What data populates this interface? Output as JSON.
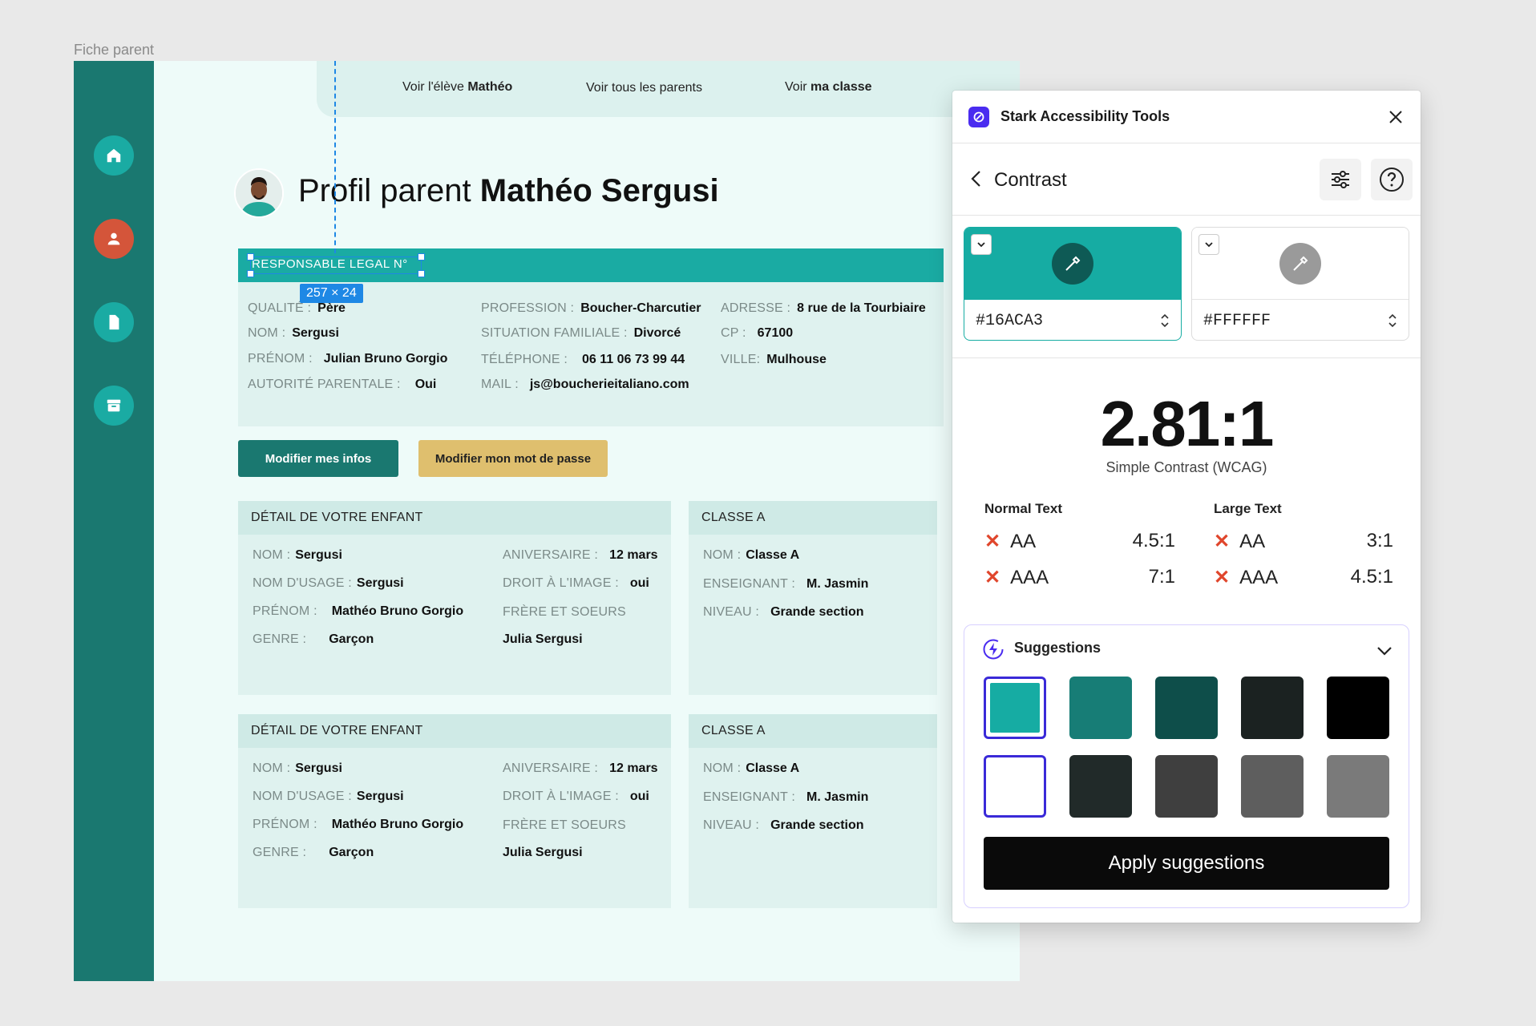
{
  "canvas": {
    "frame_label": "Fiche parent"
  },
  "topnav": [
    {
      "prefix": "Voir l'élève ",
      "bold": "Mathéo"
    },
    {
      "prefix": "Voir tous les parents",
      "bold": ""
    },
    {
      "prefix": "Voir ",
      "bold": "ma classe"
    }
  ],
  "page": {
    "title_prefix": "Profil parent ",
    "title_name": "Mathéo Sergusi"
  },
  "section_bar": {
    "label": "RESPONSABLE LEGAL N°",
    "selection_size": "257 × 24"
  },
  "parent_info": {
    "qualite": {
      "label": "QUALITÉ :",
      "value": "Père"
    },
    "nom": {
      "label": "NOM :",
      "value": "Sergusi"
    },
    "prenom": {
      "label": "PRÉNOM :",
      "value": "Julian Bruno Gorgio"
    },
    "autorite": {
      "label": "AUTORITÉ PARENTALE :",
      "value": "Oui"
    },
    "profession": {
      "label": "PROFESSION :",
      "value": "Boucher-Charcutier"
    },
    "situation": {
      "label": "SITUATION FAMILIALE :",
      "value": "Divorcé"
    },
    "telephone": {
      "label": "TÉLÉPHONE :",
      "value": "06 11 06 73 99 44"
    },
    "mail": {
      "label": "MAIL :",
      "value": "js@boucherieitaliano.com"
    },
    "adresse": {
      "label": "ADRESSE :",
      "value": "8 rue de la Tourbiaire"
    },
    "cp": {
      "label": "CP :",
      "value": "67100"
    },
    "ville": {
      "label": "VILLE:",
      "value": "Mulhouse"
    }
  },
  "buttons": {
    "edit_info": "Modifier mes infos",
    "edit_password": "Modifier mon mot de passe"
  },
  "children": [
    {
      "title": "DÉTAIL DE VOTRE ENFANT",
      "nom": {
        "label": "NOM :",
        "value": "Sergusi"
      },
      "nom_usage": {
        "label": "NOM D'USAGE :",
        "value": "Sergusi"
      },
      "prenom": {
        "label": "PRÉNOM :",
        "value": "Mathéo Bruno Gorgio"
      },
      "genre": {
        "label": "GENRE :",
        "value": "Garçon"
      },
      "anniversaire": {
        "label": "ANIVERSAIRE :",
        "value": "12 mars"
      },
      "droit_image": {
        "label": "DROIT À L'IMAGE :",
        "value": "oui"
      },
      "freres": {
        "label": "FRÈRE ET SOEURS",
        "value": "Julia Sergusi"
      },
      "classe": {
        "title": "CLASSE A",
        "nom": {
          "label": "NOM :",
          "value": "Classe A"
        },
        "enseignant": {
          "label": "ENSEIGNANT :",
          "value": "M. Jasmin"
        },
        "niveau": {
          "label": "NIVEAU :",
          "value": "Grande section"
        }
      }
    },
    {
      "title": "DÉTAIL DE VOTRE ENFANT",
      "nom": {
        "label": "NOM :",
        "value": "Sergusi"
      },
      "nom_usage": {
        "label": "NOM D'USAGE :",
        "value": "Sergusi"
      },
      "prenom": {
        "label": "PRÉNOM :",
        "value": "Mathéo Bruno Gorgio"
      },
      "genre": {
        "label": "GENRE :",
        "value": "Garçon"
      },
      "anniversaire": {
        "label": "ANIVERSAIRE :",
        "value": "12 mars"
      },
      "droit_image": {
        "label": "DROIT À L'IMAGE :",
        "value": "oui"
      },
      "freres": {
        "label": "FRÈRE ET SOEURS",
        "value": "Julia Sergusi"
      },
      "classe": {
        "title": "CLASSE A",
        "nom": {
          "label": "NOM :",
          "value": "Classe A"
        },
        "enseignant": {
          "label": "ENSEIGNANT :",
          "value": "M. Jasmin"
        },
        "niveau": {
          "label": "NIVEAU :",
          "value": "Grande section"
        }
      }
    }
  ],
  "sidebar_icons": [
    "home-icon",
    "user-icon",
    "document-icon",
    "archive-icon"
  ],
  "stark": {
    "title": "Stark Accessibility Tools",
    "subtitle": "Contrast",
    "foreground": {
      "hex": "#16ACA3"
    },
    "background": {
      "hex": "#FFFFFF"
    },
    "ratio": "2.81:1",
    "ratio_label": "Simple Contrast (WCAG)",
    "normal_text": {
      "heading": "Normal Text",
      "aa": {
        "label": "AA",
        "target": "4.5:1",
        "pass": false
      },
      "aaa": {
        "label": "AAA",
        "target": "7:1",
        "pass": false
      }
    },
    "large_text": {
      "heading": "Large Text",
      "aa": {
        "label": "AA",
        "target": "3:1",
        "pass": false
      },
      "aaa": {
        "label": "AAA",
        "target": "4.5:1",
        "pass": false
      }
    },
    "suggestions": {
      "title": "Suggestions",
      "foreground_colors": [
        "#16ACA3",
        "#177D76",
        "#0E4E4A",
        "#1B2221",
        "#000000"
      ],
      "background_colors": [
        "#FFFFFF",
        "#212A29",
        "#3F3F3F",
        "#5E5E5E",
        "#7A7A7A"
      ],
      "apply_label": "Apply suggestions"
    }
  },
  "colors": {
    "sidebar": "#1A7870",
    "accent": "#1AABA3",
    "alert": "#D4553A",
    "stark_brand": "#4A2CF0",
    "fail": "#E0462C"
  }
}
